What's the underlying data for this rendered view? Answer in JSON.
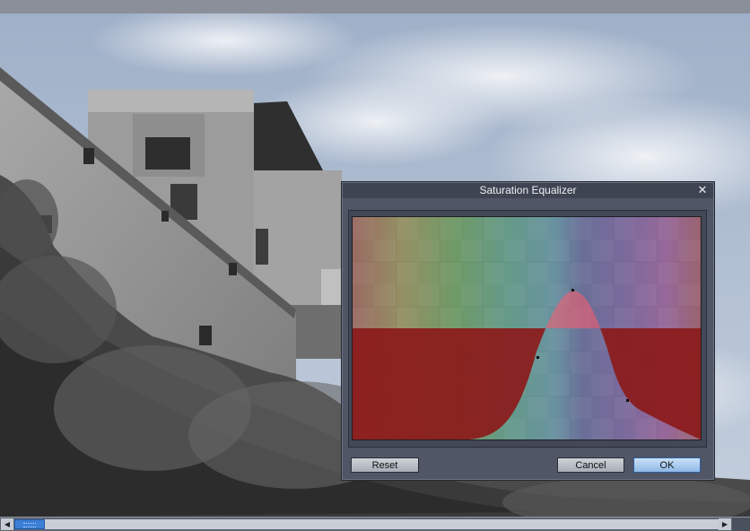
{
  "dialog": {
    "title": "Saturation Equalizer",
    "buttons": {
      "reset": "Reset",
      "cancel": "Cancel",
      "ok": "OK"
    }
  },
  "equalizer": {
    "curve_peak_hue": "blue-violet",
    "colors": {
      "mask": "#8b1a1a",
      "curve_fill": "#e06570",
      "accent": "#3c7fd6"
    }
  },
  "icons": {
    "close": "close-icon",
    "scroll_left": "arrow-left-icon",
    "scroll_right": "arrow-right-icon"
  }
}
